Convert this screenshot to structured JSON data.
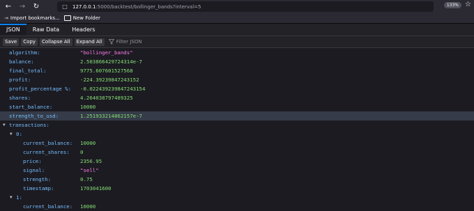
{
  "browser": {
    "url_host": "127.0.0.1",
    "url_rest": ":5000/backtest/bollinger_bands?interval=5",
    "zoom": "133%"
  },
  "bookmarks": [
    {
      "label": "Import bookmarks..."
    },
    {
      "label": "New Folder"
    }
  ],
  "tabs": [
    {
      "label": "JSON"
    },
    {
      "label": "Raw Data"
    },
    {
      "label": "Headers"
    }
  ],
  "toolbar": {
    "save": "Save",
    "copy": "Copy",
    "collapse_all": "Collapse All",
    "expand_all": "Expand All",
    "filter_placeholder": "Filter JSON"
  },
  "rows": [
    {
      "key": "algorithm:",
      "value": "\"bollinger_bands\"",
      "type": "str"
    },
    {
      "key": "balance:",
      "value": "2.503866429724314e-7",
      "type": "num"
    },
    {
      "key": "final_total:",
      "value": "9775.607601527568",
      "type": "num"
    },
    {
      "key": "profit:",
      "value": "-224.39239847243152",
      "type": "num"
    },
    {
      "key": "profit_percentage %:",
      "value": "-0.022439239847243154",
      "type": "num"
    },
    {
      "key": "shares:",
      "value": "4.264038797489325",
      "type": "num"
    },
    {
      "key": "start_balance:",
      "value": "10000",
      "type": "num"
    },
    {
      "key": "strength_to_usd:",
      "value": "1.251933214862157e-7",
      "type": "num"
    },
    {
      "key": "transactions:",
      "value": "",
      "type": "obj"
    },
    {
      "key": "0:",
      "value": "",
      "type": "obj"
    },
    {
      "key": "current_balance:",
      "value": "10000",
      "type": "num"
    },
    {
      "key": "current_shares:",
      "value": "0",
      "type": "num"
    },
    {
      "key": "price:",
      "value": "2356.95",
      "type": "num"
    },
    {
      "key": "signal:",
      "value": "\"sell\"",
      "type": "str"
    },
    {
      "key": "strength:",
      "value": "0.75",
      "type": "num"
    },
    {
      "key": "timestamp:",
      "value": "1703041600",
      "type": "num"
    },
    {
      "key": "1:",
      "value": "",
      "type": "obj"
    },
    {
      "key": "current_balance:",
      "value": "10000",
      "type": "num"
    }
  ]
}
